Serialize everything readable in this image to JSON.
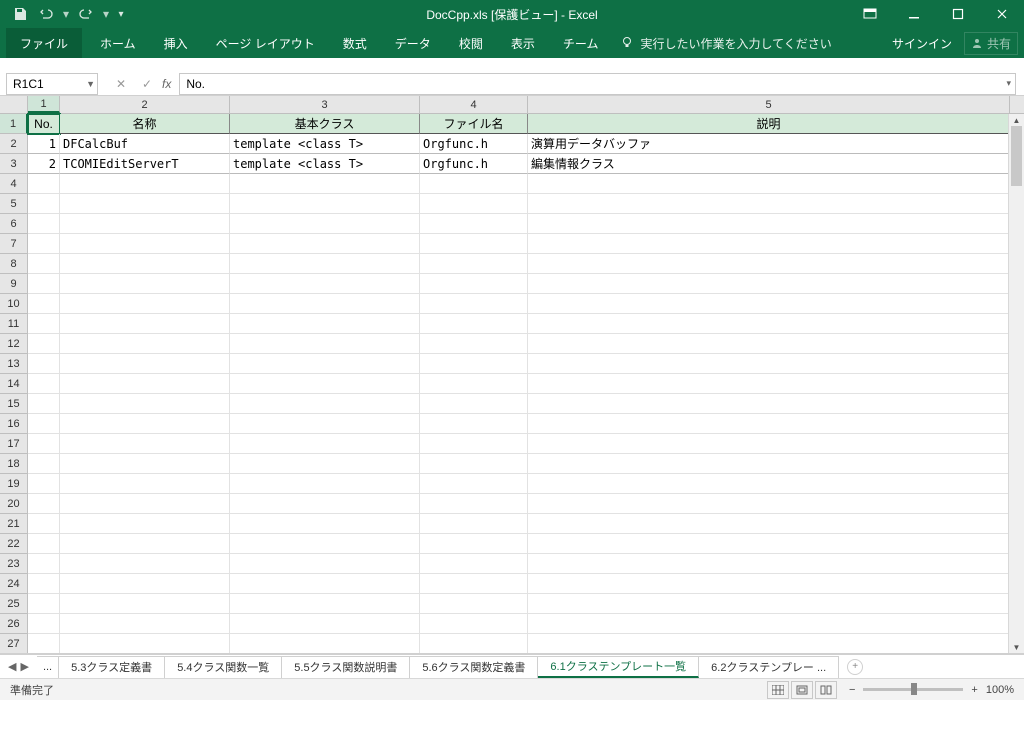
{
  "title": "DocCpp.xls [保護ビュー] - Excel",
  "ribbon": {
    "file": "ファイル",
    "tabs": [
      "ホーム",
      "挿入",
      "ページ レイアウト",
      "数式",
      "データ",
      "校閲",
      "表示",
      "チーム"
    ],
    "tellme": "実行したい作業を入力してください",
    "signin": "サインイン",
    "share": "共有"
  },
  "fx": {
    "namebox": "R1C1",
    "formula": "No."
  },
  "columns": [
    "1",
    "2",
    "3",
    "4",
    "5"
  ],
  "headers": {
    "no": "No.",
    "name": "名称",
    "base": "基本クラス",
    "file": "ファイル名",
    "desc": "説明"
  },
  "rows": [
    {
      "no": "1",
      "name": "DFCalcBuf",
      "base": "template <class T>",
      "file": "Orgfunc.h",
      "desc": "演算用データバッファ"
    },
    {
      "no": "2",
      "name": "TCOMIEditServerT",
      "base": "template <class T>",
      "file": "Orgfunc.h",
      "desc": "編集情報クラス"
    }
  ],
  "sheets": {
    "more": "...",
    "items": [
      "5.3クラス定義書",
      "5.4クラス関数一覧",
      "5.5クラス関数説明書",
      "5.6クラス関数定義書",
      "6.1クラステンプレート一覧",
      "6.2クラステンプレー ..."
    ],
    "active": 4
  },
  "status": {
    "ready": "準備完了",
    "zoom": "100%"
  }
}
